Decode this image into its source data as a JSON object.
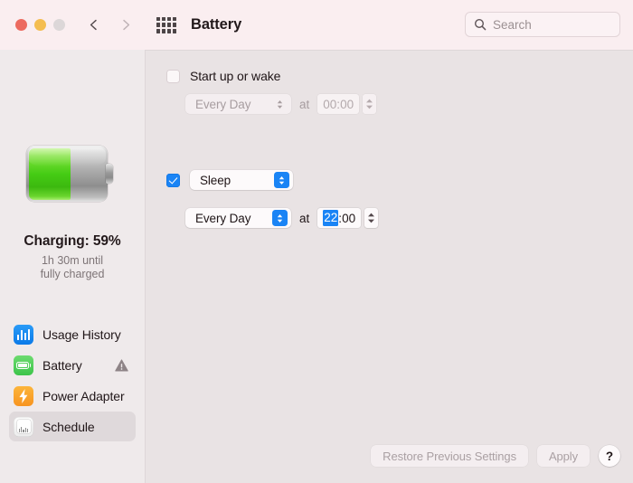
{
  "window": {
    "title": "Battery",
    "traffic_lights": [
      "close",
      "minimize",
      "zoom"
    ],
    "back_icon": "chevron-left-icon",
    "forward_icon": "chevron-right-icon",
    "grid_icon": "grid-icon"
  },
  "search": {
    "placeholder": "Search",
    "value": "",
    "icon": "search-icon"
  },
  "sidebar": {
    "battery": {
      "icon": "battery-graphic",
      "percent": 59,
      "fill_color": "#45cc14",
      "status": "Charging: 59%",
      "detail_line1": "1h 30m until",
      "detail_line2": "fully charged"
    },
    "items": [
      {
        "label": "Usage History",
        "icon": "usage-history-icon",
        "icon_color": "#0b7ae8",
        "selected": false,
        "badge": null
      },
      {
        "label": "Battery",
        "icon": "battery-icon",
        "icon_color": "#3cc44a",
        "selected": false,
        "badge": "warning-triangle-icon"
      },
      {
        "label": "Power Adapter",
        "icon": "power-adapter-icon",
        "icon_color": "#f79420",
        "selected": false,
        "badge": null
      },
      {
        "label": "Schedule",
        "icon": "schedule-icon",
        "icon_color": "#d93c2e",
        "selected": true,
        "badge": null
      }
    ]
  },
  "main": {
    "startup": {
      "checkbox_label": "Start up or wake",
      "checked": false,
      "enabled": false,
      "day_value": "Every Day",
      "at_label": "at",
      "time_hour": "00",
      "time_separator": ":",
      "time_minute": "00",
      "hour_selected": false
    },
    "sleep": {
      "checked": true,
      "enabled": true,
      "action_value": "Sleep",
      "day_value": "Every Day",
      "at_label": "at",
      "time_hour": "22",
      "time_separator": ":",
      "time_minute": "00",
      "hour_selected": true
    }
  },
  "footer": {
    "restore_label": "Restore Previous Settings",
    "restore_enabled": false,
    "apply_label": "Apply",
    "apply_enabled": false,
    "help_label": "?",
    "help_enabled": true
  },
  "colors": {
    "accent": "#1a84f5",
    "titlebar": "#faeef0",
    "sidebar": "#efeaeb",
    "content": "#e9e3e4",
    "warning": "#8e8487"
  }
}
